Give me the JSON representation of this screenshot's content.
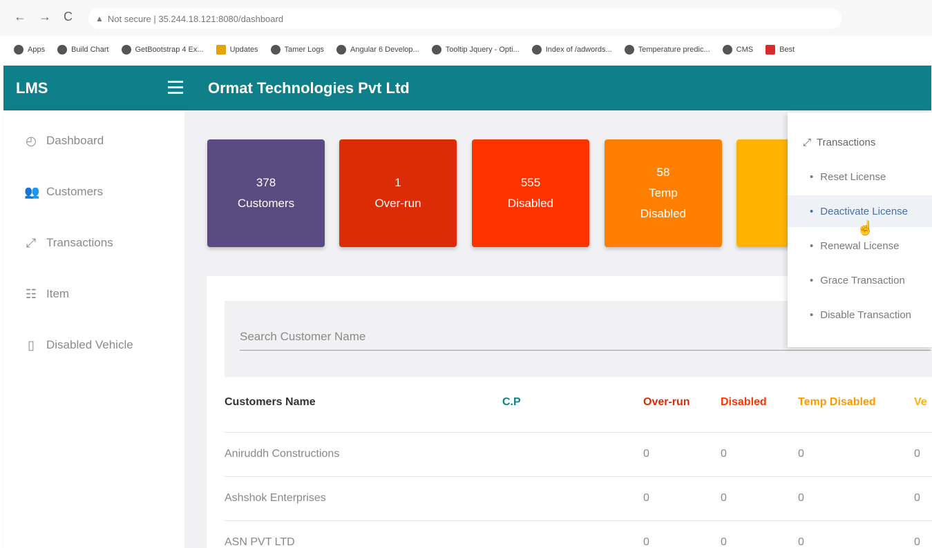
{
  "browser": {
    "nav": {
      "back": "←",
      "forward": "→",
      "reload": "C"
    },
    "address": "Not secure | 35.244.18.121:8080/dashboard",
    "bookmarks": [
      {
        "label": "Apps",
        "icon": "apps-grid-icon"
      },
      {
        "label": "Build Chart",
        "icon": "globe-icon"
      },
      {
        "label": "GetBootstrap 4 Ex...",
        "icon": "globe-icon"
      },
      {
        "label": "Updates",
        "icon": "document-icon"
      },
      {
        "label": "Tamer Logs",
        "icon": "globe-icon"
      },
      {
        "label": "Angular 6 Develop...",
        "icon": "pin-icon"
      },
      {
        "label": "Tooltip Jquery - Opti...",
        "icon": "globe-icon"
      },
      {
        "label": "Index of /adwords...",
        "icon": "globe-icon"
      },
      {
        "label": "Temperature predic...",
        "icon": "chart-icon"
      },
      {
        "label": "CMS",
        "icon": "user-icon"
      },
      {
        "label": "Best",
        "icon": "l-icon"
      }
    ]
  },
  "app": {
    "title": "LMS",
    "company": "Ormat Technologies Pvt Ltd",
    "accent": "#0f7f8a"
  },
  "sidebar": {
    "items": [
      {
        "label": "Dashboard",
        "icon": "dashboard-icon",
        "glyph": "◴",
        "active": true
      },
      {
        "label": "Customers",
        "icon": "customers-icon",
        "glyph": "👥",
        "active": false
      },
      {
        "label": "Transactions",
        "icon": "transactions-icon",
        "glyph": "⤢",
        "active": false
      },
      {
        "label": "Item",
        "icon": "item-icon",
        "glyph": "☷",
        "active": false
      },
      {
        "label": "Disabled Vehicle",
        "icon": "vehicle-icon",
        "glyph": "▯",
        "active": false
      }
    ]
  },
  "cards": [
    {
      "value": "378",
      "label": "Customers",
      "label2": "",
      "color": "#5b4b80"
    },
    {
      "value": "1",
      "label": "Over-run",
      "label2": "",
      "color": "#db2b07"
    },
    {
      "value": "555",
      "label": "Disabled",
      "label2": "",
      "color": "#ff3300"
    },
    {
      "value": "58",
      "label": "Temp",
      "label2": "Disabled",
      "color": "#ff8000"
    },
    {
      "value": "",
      "label": "",
      "label2": "",
      "color": "#ffb300"
    }
  ],
  "search": {
    "placeholder": "Search Customer Name"
  },
  "table": {
    "headers": [
      {
        "label": "Customers Name",
        "color": "#333333"
      },
      {
        "label": "C.P",
        "color": "#0f7f8a"
      },
      {
        "label": "Over-run",
        "color": "#db2b07"
      },
      {
        "label": "Disabled",
        "color": "#ff3300"
      },
      {
        "label": "Temp Disabled",
        "color": "#ff9800"
      },
      {
        "label": "Ve",
        "color": "#ffb300"
      }
    ],
    "rows": [
      {
        "name": "Aniruddh Constructions",
        "cp": "",
        "over_run": "0",
        "disabled": "0",
        "temp_disabled": "0",
        "ve": "0"
      },
      {
        "name": "Ashshok Enterprises",
        "cp": "",
        "over_run": "0",
        "disabled": "0",
        "temp_disabled": "0",
        "ve": "0"
      },
      {
        "name": "ASN PVT LTD",
        "cp": "",
        "over_run": "0",
        "disabled": "0",
        "temp_disabled": "0",
        "ve": "0"
      }
    ]
  },
  "dropdown": {
    "header": "Transactions",
    "items": [
      {
        "label": "Reset License",
        "hover": false
      },
      {
        "label": "Deactivate License",
        "hover": true
      },
      {
        "label": "Renewal License",
        "hover": false
      },
      {
        "label": "Grace Transaction",
        "hover": false
      },
      {
        "label": "Disable Transaction",
        "hover": false
      }
    ]
  }
}
